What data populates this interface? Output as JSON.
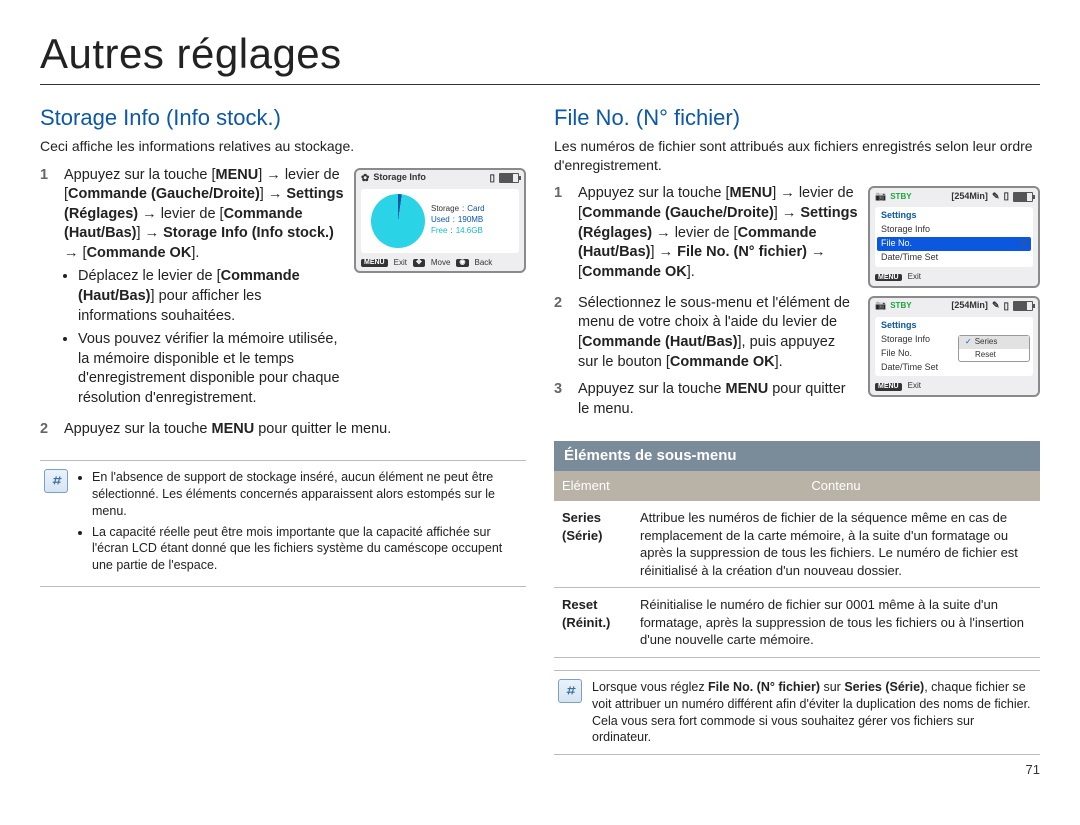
{
  "page_title": "Autres réglages",
  "page_number": "71",
  "left": {
    "heading": "Storage Info (Info stock.)",
    "intro": "Ceci affiche les informations relatives au stockage.",
    "step1_num": "1",
    "step1_a": "Appuyez sur la touche [",
    "step1_menu": "MENU",
    "step1_b": "] → levier de [",
    "step1_lr": "Commande (Gauche/Droite)",
    "step1_c": "] → ",
    "step1_settings": "Settings (Réglages)",
    "step1_d": " → levier de [",
    "step1_ud": "Commande (Haut/Bas)",
    "step1_e": "] → ",
    "step1_target": "Storage Info (Info stock.)",
    "step1_f": " → [",
    "step1_ok": "Commande OK",
    "step1_g": "].",
    "bullet1_a": "Déplacez le levier de [",
    "bullet1_b": "] pour afficher les informations souhaitées.",
    "bullet2": "Vous pouvez vérifier la mémoire utilisée, la mémoire disponible et le temps d'enregistrement disponible pour chaque résolution d'enregistrement.",
    "step2_num": "2",
    "step2_a": "Appuyez sur la touche ",
    "step2_b": " pour quitter le menu.",
    "note1": "En l'absence de support de stockage inséré, aucun élément ne peut être sélectionné. Les éléments concernés apparaissent alors estompés sur le menu.",
    "note2": "La capacité réelle peut être mois importante que la capacité affichée sur l'écran LCD étant donné que les fichiers système du caméscope occupent une partie de l'espace.",
    "lcd": {
      "title": "Storage Info",
      "storage_k": "Storage",
      "storage_v": "Card",
      "used_k": "Used",
      "used_v": "190MB",
      "free_k": "Free",
      "free_v": "14.6GB",
      "exit": "Exit",
      "move": "Move",
      "back": "Back",
      "btn_menu": "MENU"
    }
  },
  "right": {
    "heading": "File No. (N° fichier)",
    "intro": "Les numéros de fichier sont attribués aux fichiers enregistrés selon leur ordre d'enregistrement.",
    "step1_num": "1",
    "step1_a": "Appuyez sur la touche [",
    "step1_menu": "MENU",
    "step1_b": "] → levier de [",
    "step1_lr": "Commande (Gauche/Droite)",
    "step1_c": "] → ",
    "step1_settings": "Settings (Réglages)",
    "step1_d": " → levier de [",
    "step1_ud": "Commande (Haut/Bas)",
    "step1_e": "] → ",
    "step1_target": "File No. (N° fichier)",
    "step1_f": " → [",
    "step1_ok": "Commande OK",
    "step1_g": "].",
    "step2_num": "2",
    "step2": "Sélectionnez le sous-menu et l'élément de menu de votre choix à l'aide du levier de [",
    "step2_ud": "Commande (Haut/Bas)",
    "step2_b": "], puis appuyez sur le bouton [",
    "step2_ok": "Commande OK",
    "step2_c": "].",
    "step3_num": "3",
    "step3_a": "Appuyez sur la touche ",
    "step3_b": " pour quitter le menu.",
    "lcd1": {
      "stby": "STBY",
      "mins": "[254Min]",
      "row_settings": "Settings",
      "row_storage": "Storage Info",
      "row_fileno": "File No.",
      "row_datetime": "Date/Time Set",
      "exit": "Exit",
      "btn_menu": "MENU"
    },
    "lcd2": {
      "stby": "STBY",
      "mins": "[254Min]",
      "row_settings": "Settings",
      "row_storage": "Storage Info",
      "row_fileno": "File No.",
      "row_datetime": "Date/Time Set",
      "opt_series": "Series",
      "opt_reset": "Reset",
      "exit": "Exit",
      "btn_menu": "MENU"
    },
    "submenu_heading": "Éléments de sous-menu",
    "th1": "Elément",
    "th2": "Contenu",
    "row_series_l1": "Series",
    "row_series_l2": "(Série)",
    "row_series_desc": "Attribue les numéros de fichier de la séquence même en cas de remplacement de la carte mémoire, à la suite d'un formatage ou après la suppression de tous les fichiers. Le numéro de fichier est réinitialisé à la création d'un nouveau dossier.",
    "row_reset_l1": "Reset",
    "row_reset_l2": "(Réinit.)",
    "row_reset_desc": "Réinitialise le numéro de fichier sur 0001 même à la suite d'un formatage, après la suppression de tous les fichiers ou à l'insertion d'une nouvelle carte mémoire.",
    "note_a": "Lorsque vous réglez ",
    "note_b": "File No. (N° fichier)",
    "note_c": " sur ",
    "note_d": "Series (Série)",
    "note_e": ", chaque fichier se voit attribuer un numéro différent afin d'éviter la duplication des noms de fichier. Cela vous sera fort commode si vous souhaitez gérer vos fichiers sur ordinateur."
  }
}
